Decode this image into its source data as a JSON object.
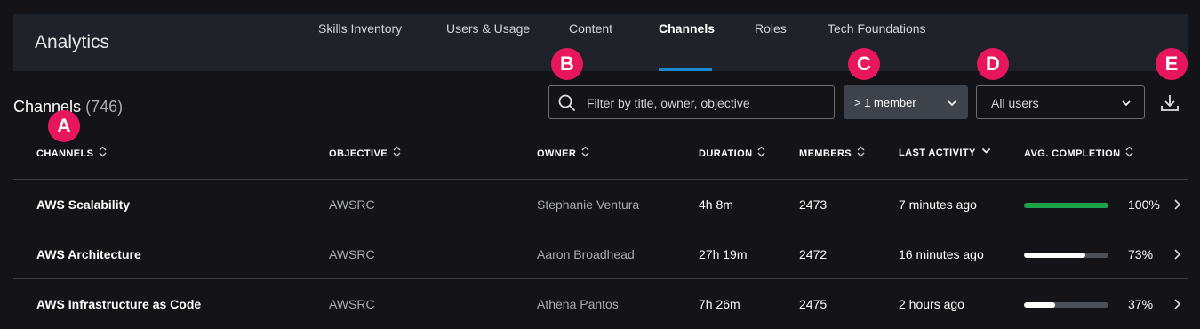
{
  "header": {
    "app_title": "Analytics",
    "tabs": [
      {
        "label": "Skills Inventory",
        "active": false
      },
      {
        "label": "Users & Usage",
        "active": false
      },
      {
        "label": "Content",
        "active": false
      },
      {
        "label": "Channels",
        "active": true
      },
      {
        "label": "Roles",
        "active": false
      },
      {
        "label": "Tech Foundations",
        "active": false
      }
    ],
    "accent_color": "#1a8ad1"
  },
  "page": {
    "title": "Channels",
    "count": "(746)"
  },
  "filters": {
    "search_placeholder": "Filter by title, owner, objective",
    "search_icon": "search-icon",
    "members_selected": "> 1 member",
    "users_selected": "All users",
    "download_icon": "download-icon"
  },
  "table": {
    "columns": [
      "CHANNELS",
      "OBJECTIVE",
      "OWNER",
      "DURATION",
      "MEMBERS",
      "LAST ACTIVITY",
      "AVG. COMPLETION"
    ],
    "rows": [
      {
        "channel": "AWS Scalability",
        "objective": "AWSRC",
        "owner": "Stephanie Ventura",
        "duration": "4h 8m",
        "members": "2473",
        "last_activity": "7 minutes ago",
        "completion": 1.0,
        "completion_label": "100%",
        "bar_color": "#1fa34a"
      },
      {
        "channel": "AWS Architecture",
        "objective": "AWSRC",
        "owner": "Aaron Broadhead",
        "duration": "27h 19m",
        "members": "2472",
        "last_activity": "16 minutes ago",
        "completion": 0.73,
        "completion_label": "73%",
        "bar_color": "#ffffff"
      },
      {
        "channel": "AWS Infrastructure as Code",
        "objective": "AWSRC",
        "owner": "Athena Pantos",
        "duration": "7h 26m",
        "members": "2475",
        "last_activity": "2 hours ago",
        "completion": 0.37,
        "completion_label": "37%",
        "bar_color": "#ffffff"
      }
    ]
  },
  "callouts": [
    "A",
    "B",
    "C",
    "D",
    "E"
  ],
  "callout_color": "#e8175d"
}
